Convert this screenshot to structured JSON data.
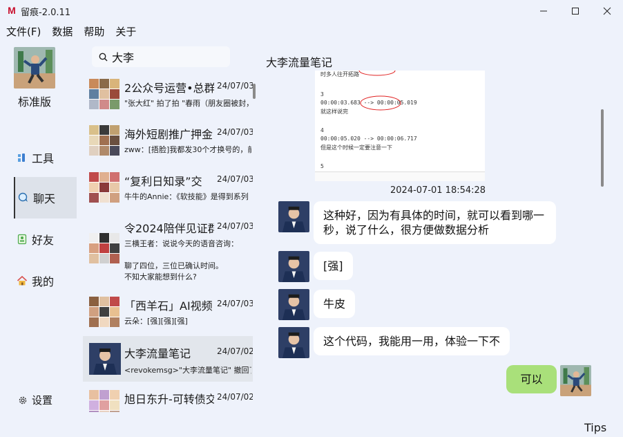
{
  "window": {
    "title": "留痕-2.0.11",
    "logo_letter": "M",
    "minimize_glyph": "—",
    "maximize_glyph": "☐",
    "close_glyph": "✕"
  },
  "menu": [
    "文件(F)",
    "数据",
    "帮助",
    "关于"
  ],
  "sidebar": {
    "version_label": "标准版",
    "items": [
      {
        "label": "工具",
        "icon": "tools-icon"
      },
      {
        "label": "聊天",
        "icon": "chat-icon",
        "active": true
      },
      {
        "label": "好友",
        "icon": "contacts-icon"
      },
      {
        "label": "我的",
        "icon": "home-icon"
      }
    ],
    "settings_label": "设置"
  },
  "search": {
    "value": "大李"
  },
  "conversations": [
    {
      "name": "2公众号运营•总群",
      "time": "24/07/03",
      "lines": [
        "\"张大红\" 拍了拍 \"春雨（朋友圈被封，"
      ]
    },
    {
      "name": "海外短剧推广押金",
      "time": "24/07/03",
      "lines": [
        "zww：[捂脸]我都发30个才换号的，前"
      ]
    },
    {
      "name": "“复利日知录”交",
      "time": "24/07/03",
      "lines": [
        "牛牛的Annie：《软技能》是得到系列"
      ]
    },
    {
      "name": "令2024陪伴见证群",
      "time": "24/07/03",
      "lines": [
        "三横王者：说说今天的语音咨询：",
        "",
        "聊了四位，三位已确认时间。",
        "不知大家能想到什么?"
      ]
    },
    {
      "name": "「西羊石」AI视频",
      "time": "24/07/03",
      "lines": [
        "云朵：[强][强][强]"
      ]
    },
    {
      "name": "大李流量笔记",
      "time": "24/07/02",
      "lines": [
        "<revokemsg>\"大李流量笔记\" 撤回了"
      ],
      "selected": true
    },
    {
      "name": "旭日东升-可转债交",
      "time": "24/07/02",
      "lines": [
        ""
      ]
    }
  ],
  "chat": {
    "title": "大李流量笔记",
    "image_lines": [
      "时多人往开拓路",
      "3",
      "00:00:03.683 --> 00:00:05.019",
      "就这样说完",
      "4",
      "00:00:05.020 --> 00:00:06.717",
      "但是这个时候一定要注意一下",
      "5"
    ],
    "timestamp": "2024-07-01 18:54:28",
    "messages": [
      {
        "text": "这种好，因为有具体的时间，就可以看到哪一秒，说了什么，很方便做数据分析",
        "mine": false
      },
      {
        "text": "[强]",
        "mine": false
      },
      {
        "text": "牛皮",
        "mine": false
      },
      {
        "text": "这个代码，我能用一用，体验一下不",
        "mine": false
      },
      {
        "text": "可以",
        "mine": true
      }
    ]
  },
  "tips_label": "Tips",
  "colors": {
    "background": "#eef2fb",
    "my_bubble": "#a9e07a",
    "other_bubble": "#ffffff",
    "logo_red": "#c8102e"
  }
}
